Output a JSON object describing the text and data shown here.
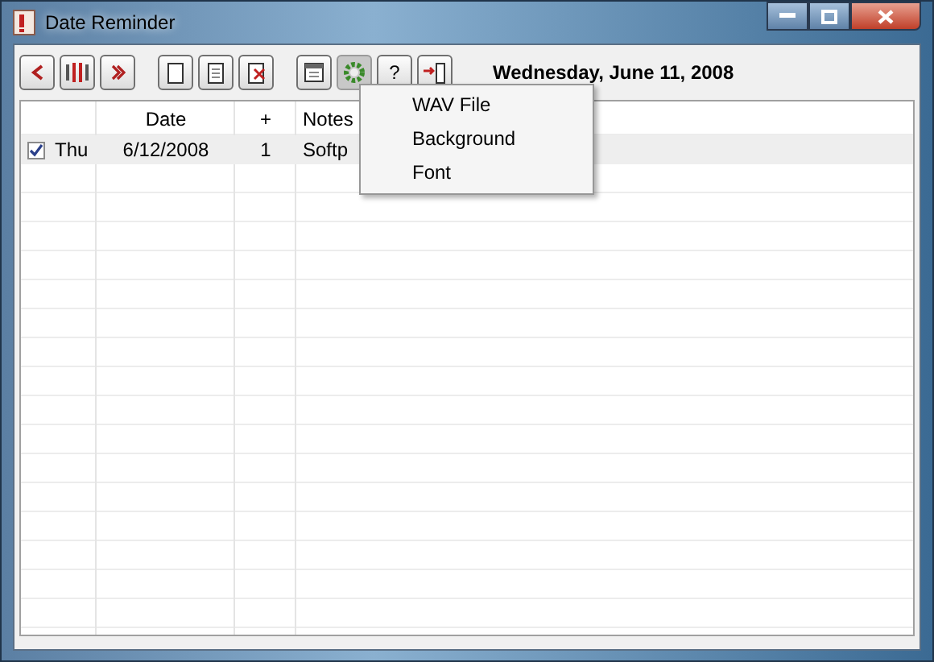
{
  "window": {
    "title": "Date Reminder"
  },
  "toolbar": {
    "buttons": [
      {
        "kind": "prev"
      },
      {
        "kind": "today"
      },
      {
        "kind": "next"
      },
      {
        "kind": "new"
      },
      {
        "kind": "edit"
      },
      {
        "kind": "delete"
      },
      {
        "kind": "calendar"
      },
      {
        "kind": "settings",
        "pressed": true
      },
      {
        "kind": "help",
        "label": "?"
      },
      {
        "kind": "exit"
      }
    ],
    "date": "Wednesday, June 11, 2008"
  },
  "table": {
    "columns": [
      "",
      "Date",
      "+",
      "Notes"
    ],
    "rows": [
      {
        "checked": true,
        "day": "Thu",
        "date": "6/12/2008",
        "count": "1",
        "notes": "Softp",
        "selected": true
      }
    ]
  },
  "menu": {
    "items": [
      "WAV File",
      "Background",
      "Font"
    ]
  }
}
